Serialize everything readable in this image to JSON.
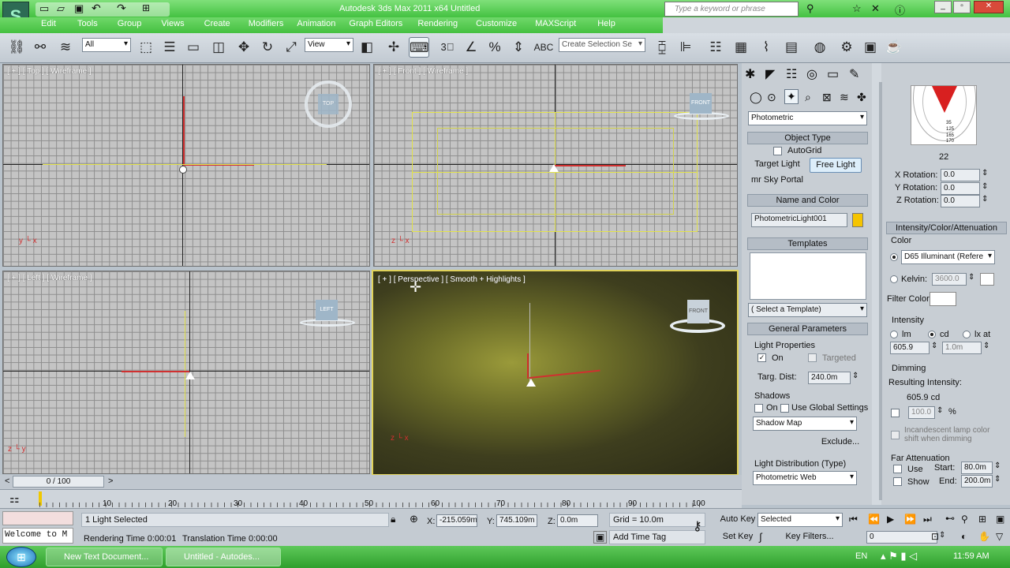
{
  "window": {
    "title": "Autodesk 3ds Max  2011 x64      Untitled",
    "search_placeholder": "Type a keyword or phrase"
  },
  "menu": [
    "Edit",
    "Tools",
    "Group",
    "Views",
    "Create",
    "Modifiers",
    "Animation",
    "Graph Editors",
    "Rendering",
    "Customize",
    "MAXScript",
    "Help"
  ],
  "toolbar": {
    "filter": "All",
    "coord": "View",
    "named_selection": "Create Selection Se"
  },
  "viewports": {
    "top": "[ + ] [ Top ] [ Wireframe ]",
    "front": "[ + ] [ Front ] [ Wireframe ]",
    "left": "[ + ] [ Left ] [ Wireframe ]",
    "persp": "[ + ] [ Perspective ] [ Smooth + Highlights ]",
    "viewcube": {
      "top": "TOP",
      "front": "FRONT",
      "left": "LEFT"
    }
  },
  "command_panel": {
    "category": "Photometric",
    "object_type": {
      "header": "Object Type",
      "autogrid": "AutoGrid",
      "target_light": "Target Light",
      "free_light": "Free Light",
      "sky_portal": "mr Sky Portal"
    },
    "name_color": {
      "header": "Name and Color",
      "name": "PhotometricLight001",
      "color": "#f5c400"
    },
    "templates": {
      "header": "Templates",
      "select": "( Select a Template)"
    },
    "general": {
      "header": "General Parameters",
      "light_properties": "Light Properties",
      "on": "On",
      "targeted": "Targeted",
      "targ_dist_label": "Targ. Dist:",
      "targ_dist": "240.0m",
      "shadows": "Shadows",
      "shadows_on": "On",
      "use_global": "Use Global Settings",
      "shadow_type": "Shadow Map",
      "exclude": "Exclude...",
      "distribution_label": "Light Distribution (Type)",
      "distribution": "Photometric Web"
    },
    "web": {
      "value": "22",
      "x_label": "X Rotation:",
      "x": "0.0",
      "y_label": "Y Rotation:",
      "y": "0.0",
      "z_label": "Z Rotation:",
      "z": "0.0",
      "polar_labels": [
        "35",
        "125",
        "165",
        "170"
      ]
    },
    "intensity": {
      "header": "Intensity/Color/Attenuation",
      "color_label": "Color",
      "preset": "D65 Illuminant (Refere",
      "kelvin_label": "Kelvin:",
      "kelvin": "3600.0",
      "filter_label": "Filter Color:",
      "intensity_label": "Intensity",
      "lm": "lm",
      "cd": "cd",
      "lx": "lx at",
      "value": "605.9",
      "dist": "1.0m",
      "dimming_label": "Dimming",
      "resulting_label": "Resulting Intensity:",
      "resulting": "605.9 cd",
      "percent": "100.0",
      "percent_unit": "%",
      "incandescent": "Incandescent lamp color shift when dimming",
      "far_label": "Far Attenuation",
      "use": "Use",
      "show": "Show",
      "start_label": "Start:",
      "start": "80.0m",
      "end_label": "End:",
      "end": "200.0m"
    }
  },
  "timeline": {
    "frame": "0 / 100",
    "ticks": [
      "10",
      "20",
      "30",
      "40",
      "50",
      "60",
      "70",
      "80",
      "90",
      "100"
    ]
  },
  "status": {
    "script": "Welcome to M",
    "selected": "1 Light Selected",
    "rendering_time": "Rendering Time  0:00:01",
    "translation_time": "Translation Time  0:00:00",
    "x_label": "X:",
    "x": "-215.059m",
    "y_label": "Y:",
    "y": "745.109m",
    "z_label": "Z:",
    "z": "0.0m",
    "grid": "Grid = 10.0m",
    "add_time_tag": "Add Time Tag",
    "auto_key": "Auto Key",
    "key_mode": "Selected",
    "set_key": "Set Key",
    "key_filters": "Key Filters...",
    "frame": "0"
  },
  "taskbar": {
    "item1": "New Text Document...",
    "item2": "Untitled - Autodes...",
    "lang": "EN",
    "time": "11:59 AM"
  }
}
